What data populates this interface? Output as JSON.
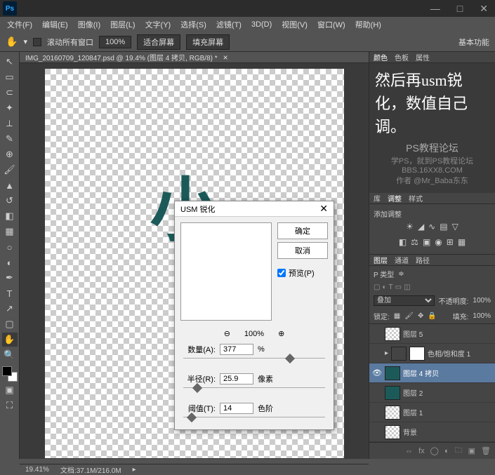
{
  "titlebar": {
    "logo": "Ps"
  },
  "window_controls": {
    "min": "—",
    "max": "□",
    "close": "✕"
  },
  "menubar": [
    "文件(F)",
    "编辑(E)",
    "图像(I)",
    "图层(L)",
    "文字(Y)",
    "选择(S)",
    "滤镜(T)",
    "3D(D)",
    "视图(V)",
    "窗口(W)",
    "帮助(H)"
  ],
  "optionsbar": {
    "scroll_all": "滚动所有窗口",
    "zoom": "100%",
    "fit_screen": "适合屏幕",
    "fill_screen": "填充屏幕",
    "essentials": "基本功能"
  },
  "doc_tab": {
    "title": "IMG_20160709_120847.psd @ 19.4% (图层 4 拷贝, RGB/8) *"
  },
  "canvas": {
    "brush_char": "小"
  },
  "statusbar": {
    "zoom": "19.41%",
    "doc": "文档:37.1M/216.0M"
  },
  "dialog": {
    "title": "USM 锐化",
    "ok": "确定",
    "cancel": "取消",
    "preview": "预览(P)",
    "zoom": "100%",
    "amount_label": "数量(A):",
    "amount_value": "377",
    "amount_unit": "%",
    "radius_label": "半径(R):",
    "radius_value": "25.9",
    "radius_unit": "像素",
    "threshold_label": "阈值(T):",
    "threshold_value": "14",
    "threshold_unit": "色阶"
  },
  "annotation": "然后再usm锐化，数值自己调。",
  "watermark": {
    "line1": "PS教程论坛",
    "line2": "学PS，就到PS教程论坛",
    "line3": "BBS.16XX8.COM",
    "line4": "作者 @Mr_Baba东东"
  },
  "panels": {
    "color_tabs": [
      "颜色",
      "色板",
      "属性"
    ],
    "adj_tabs": [
      "库",
      "调整",
      "样式"
    ],
    "adj_title": "添加调整",
    "layers_tabs": [
      "图层",
      "通道",
      "路径"
    ],
    "blend_mode": "叠加",
    "opacity_label": "不透明度:",
    "opacity_value": "100%",
    "lock_label": "锁定:",
    "fill_label": "填充:",
    "fill_value": "100%",
    "kind_label": "P 类型"
  },
  "layers": [
    {
      "name": "图层 5",
      "visible": false,
      "selected": false,
      "thumb": "checker"
    },
    {
      "name": "色相/饱和度 1",
      "visible": false,
      "selected": false,
      "thumb": "adj"
    },
    {
      "name": "图层 4 拷贝",
      "visible": true,
      "selected": true,
      "thumb": "dark"
    },
    {
      "name": "图层 2",
      "visible": false,
      "selected": false,
      "thumb": "dark"
    },
    {
      "name": "图层 1",
      "visible": false,
      "selected": false,
      "thumb": "checker"
    },
    {
      "name": "背景",
      "visible": false,
      "selected": false,
      "thumb": "checker"
    }
  ]
}
